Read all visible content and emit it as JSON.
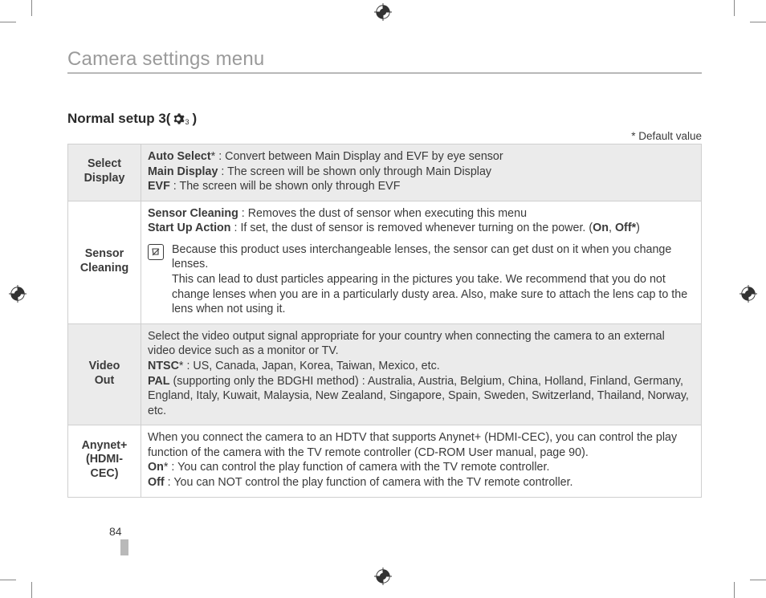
{
  "header": {
    "title": "Camera settings menu"
  },
  "subsection": {
    "title_prefix": "Normal setup 3(",
    "title_suffix": " )",
    "gear_sub": "3"
  },
  "default_note": "* Default value",
  "rows": [
    {
      "label": "Select\nDisplay",
      "l1b": "Auto Select",
      "l1star": "*",
      "l1r": " :  Convert between Main Display and EVF by eye sensor",
      "l2b": "Main Display",
      "l2r": " : The screen will be shown only through Main Display",
      "l3b": "EVF",
      "l3r": " : The screen will be shown only through EVF"
    },
    {
      "label": "Sensor\nCleaning",
      "l1b": "Sensor Cleaning",
      "l1r": " : Removes the dust of sensor when executing this menu",
      "l2b": "Start Up Action",
      "l2r": " : If set, the dust of sensor is removed whenever turning on the power. (",
      "l2_on": "On",
      "l2_sep": ", ",
      "l2_off": "Off*",
      "l2_close": ")",
      "note": "Because this product uses interchangeable lenses, the sensor can get dust on it when you change lenses.\nThis can lead to dust particles appearing in the pictures you take. We recommend that you do not change lenses when you are in a particularly dusty area. Also, make sure to attach the lens cap to the lens when not using it."
    },
    {
      "label": "Video\nOut",
      "intro": "Select the video output signal appropriate for your country when connecting the camera to an external video device such as a monitor or TV.",
      "l1b": "NTSC",
      "l1star": "*",
      "l1r": " : US, Canada, Japan, Korea, Taiwan, Mexico, etc.",
      "l2b": "PAL",
      "l2r": " (supporting only the BDGHI method) : Australia, Austria, Belgium, China, Holland, Finland, Germany, England, Italy, Kuwait, Malaysia, New Zealand, Singapore, Spain, Sweden, Switzerland, Thailand, Norway, etc."
    },
    {
      "label": "Anynet+\n(HDMI-\nCEC)",
      "intro": "When you connect the camera to an HDTV that supports Anynet+ (HDMI-CEC), you can control the play function of the camera with the TV remote controller (CD-ROM User manual, page 90).",
      "l1b": "On",
      "l1star": "*",
      "l1r": " : You can control the play function of camera with the TV remote controller.",
      "l2b": "Off",
      "l2r": " : You can NOT control the play function of camera with the TV remote controller."
    }
  ],
  "page_number": "84"
}
